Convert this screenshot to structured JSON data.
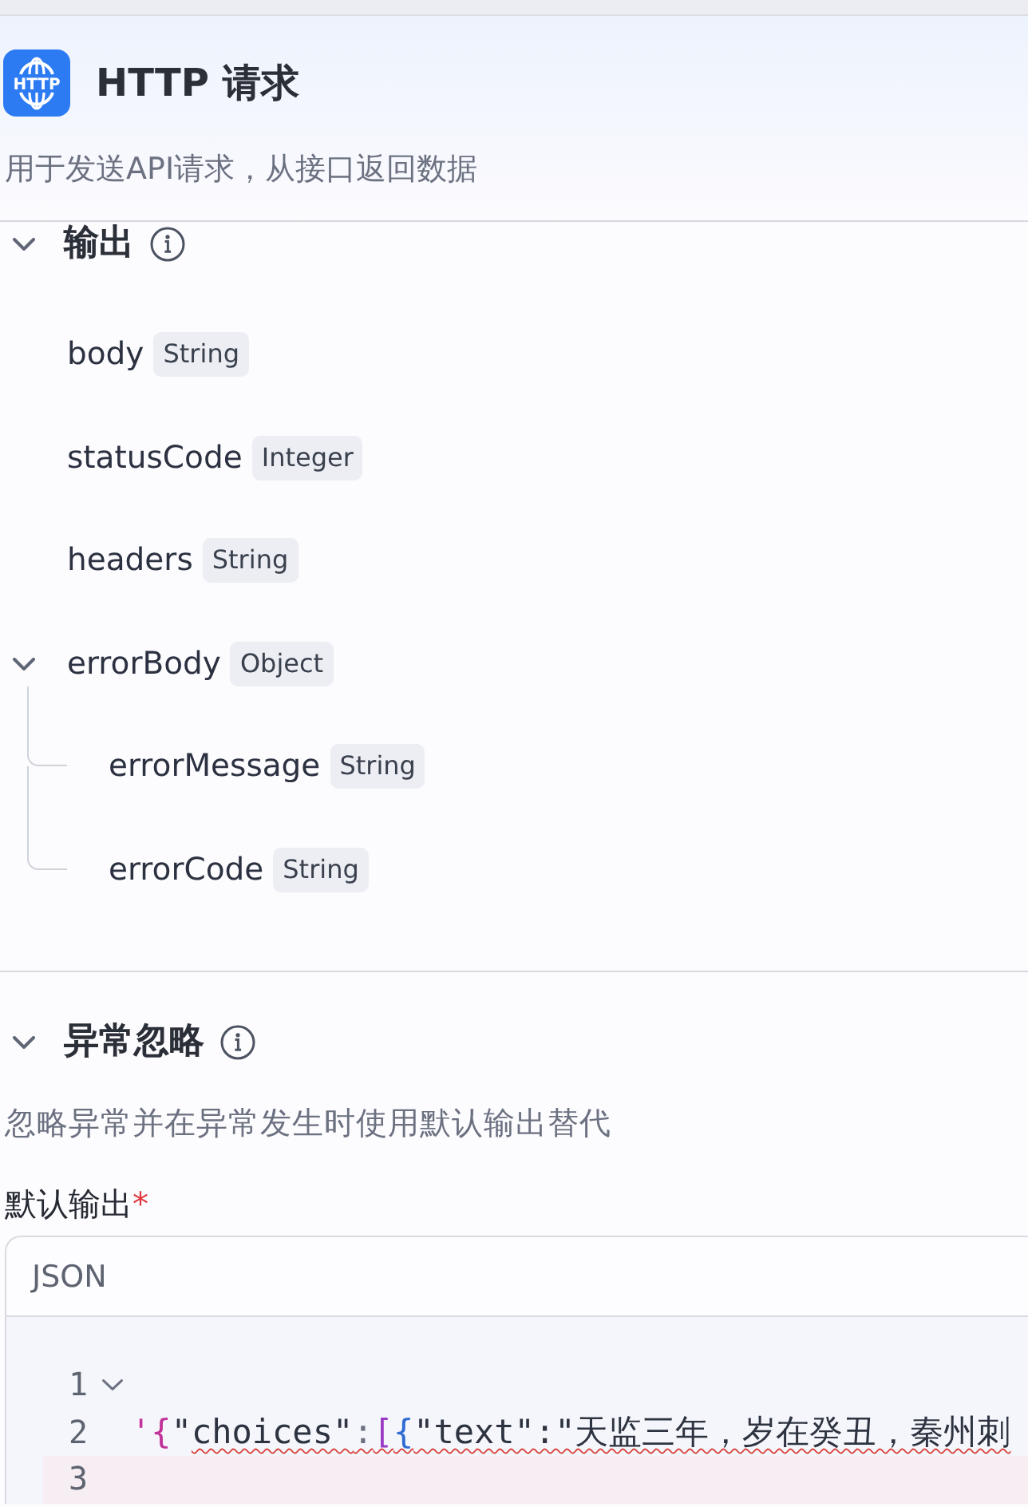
{
  "header": {
    "logo_text": "HTTP",
    "title": "HTTP 请求",
    "description": "用于发送API请求，从接口返回数据"
  },
  "output_section": {
    "title": "输出",
    "expanded": true,
    "fields": [
      {
        "name": "body",
        "type": "String"
      },
      {
        "name": "statusCode",
        "type": "Integer"
      },
      {
        "name": "headers",
        "type": "String"
      },
      {
        "name": "errorBody",
        "type": "Object",
        "expanded": true,
        "children": [
          {
            "name": "errorMessage",
            "type": "String"
          },
          {
            "name": "errorCode",
            "type": "String"
          }
        ]
      }
    ]
  },
  "error_section": {
    "title": "异常忽略",
    "expanded": true,
    "description": "忽略异常并在异常发生时使用默认输出替代",
    "default_output": {
      "label": "默认输出",
      "required_mark": "*",
      "editor": {
        "language": "JSON",
        "lines": [
          {
            "number": "1",
            "expanded": true,
            "active": false
          },
          {
            "number": "2",
            "active": false,
            "tokens": [
              {
                "text": "'",
                "kind": "quote",
                "error": false
              },
              {
                "text": "{",
                "kind": "bracket_1",
                "error": false
              },
              {
                "text": "\"",
                "kind": "plain",
                "error": false
              },
              {
                "text": "choices\"",
                "kind": "plain",
                "error": true
              },
              {
                "text": ":",
                "kind": "punct",
                "error": true
              },
              {
                "text": "[",
                "kind": "bracket_2",
                "error": true
              },
              {
                "text": "{",
                "kind": "bracket_3",
                "error": true
              },
              {
                "text": "\"text\":\"天监三年，岁在癸丑，秦州刺",
                "kind": "plain",
                "error": true
              }
            ]
          },
          {
            "number": "3",
            "active": true
          }
        ]
      }
    }
  }
}
